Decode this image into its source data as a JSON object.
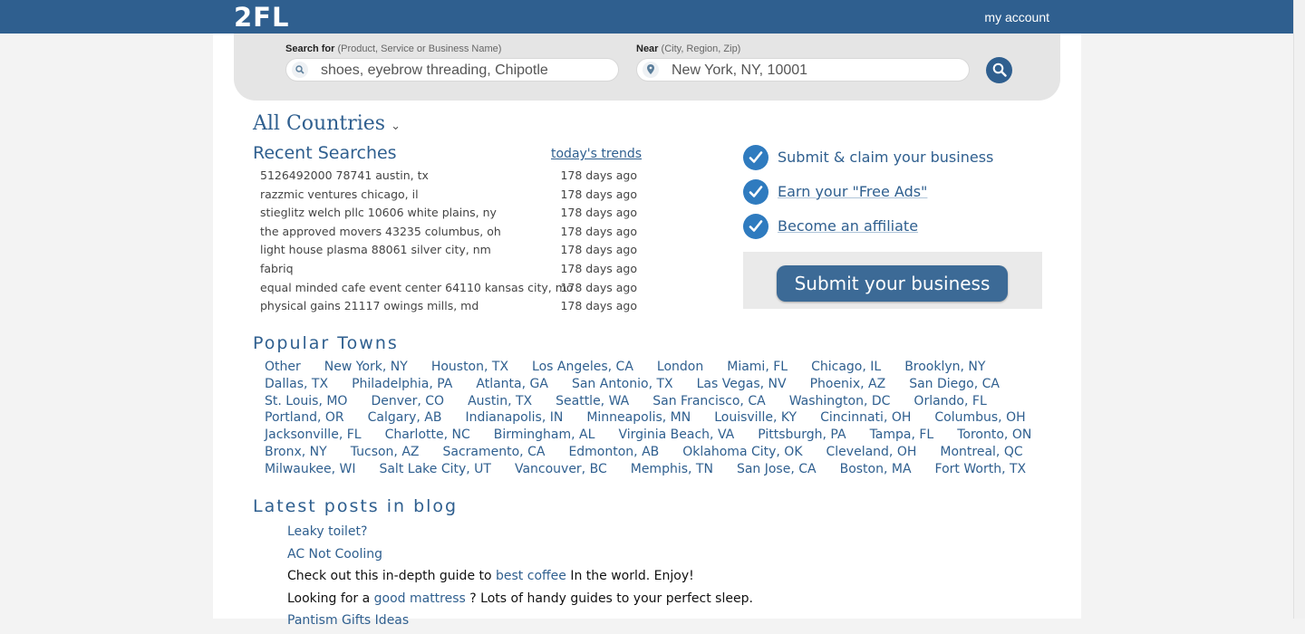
{
  "header": {
    "logo": "2FL",
    "account": "my account"
  },
  "search": {
    "what_label": "Search for",
    "what_hint": "(Product, Service or Business Name)",
    "what_placeholder": "shoes, eyebrow threading, Chipotle",
    "where_label": "Near",
    "where_hint": "(City, Region, Zip)",
    "where_placeholder": "New York, NY, 10001"
  },
  "countries": {
    "label": "All Countries"
  },
  "recent": {
    "title": "Recent Searches",
    "trends_link": "today's trends",
    "items": [
      {
        "query": "5126492000 78741 austin, tx",
        "ago": "178 days ago"
      },
      {
        "query": "razzmic ventures chicago, il",
        "ago": "178 days ago"
      },
      {
        "query": "stieglitz welch pllc 10606 white plains, ny",
        "ago": "178 days ago"
      },
      {
        "query": "the approved movers 43235 columbus, oh",
        "ago": "178 days ago"
      },
      {
        "query": "light house plasma 88061 silver city, nm",
        "ago": "178 days ago"
      },
      {
        "query": "fabriq",
        "ago": "178 days ago"
      },
      {
        "query": "equal minded cafe event center 64110 kansas city, mo",
        "ago": "178 days ago"
      },
      {
        "query": "physical gains 21117 owings mills, md",
        "ago": "178 days ago"
      }
    ]
  },
  "claims": [
    {
      "text": "Submit & claim your business"
    },
    {
      "text": "Earn your \"Free Ads\""
    },
    {
      "text": "Become an affiliate"
    }
  ],
  "submit_button": "Submit your business",
  "popular": {
    "title": "Popular Towns",
    "rows": [
      [
        "Other",
        "New York, NY",
        "Houston, TX",
        "Los Angeles, CA",
        "London",
        "Miami, FL",
        "Chicago, IL",
        "Brooklyn, NY"
      ],
      [
        "Dallas, TX",
        "Philadelphia, PA",
        "Atlanta, GA",
        "San Antonio, TX",
        "Las Vegas, NV",
        "Phoenix, AZ",
        "San Diego, CA"
      ],
      [
        "St. Louis, MO",
        "Denver, CO",
        "Austin, TX",
        "Seattle, WA",
        "San Francisco, CA",
        "Washington, DC",
        "Orlando, FL"
      ],
      [
        "Portland, OR",
        "Calgary, AB",
        "Indianapolis, IN",
        "Minneapolis, MN",
        "Louisville, KY",
        "Cincinnati, OH",
        "Columbus, OH"
      ],
      [
        "Jacksonville, FL",
        "Charlotte, NC",
        "Birmingham, AL",
        "Virginia Beach, VA",
        "Pittsburgh, PA",
        "Tampa, FL",
        "Toronto, ON"
      ],
      [
        "Bronx, NY",
        "Tucson, AZ",
        "Sacramento, CA",
        "Edmonton, AB",
        "Oklahoma City, OK",
        "Cleveland, OH",
        "Montreal, QC"
      ],
      [
        "Milwaukee, WI",
        "Salt Lake City, UT",
        "Vancouver, BC",
        "Memphis, TN",
        "San Jose, CA",
        "Boston, MA",
        "Fort Worth, TX"
      ]
    ]
  },
  "blog": {
    "title": "Latest posts in blog",
    "post1": "Leaky toilet?",
    "post2": "AC Not Cooling",
    "line3_pre": "Check out this in-depth guide to ",
    "line3_link": "best coffee",
    "line3_post": " In the world. Enjoy!",
    "line4_pre": "Looking for a ",
    "line4_link": "good mattress",
    "line4_post": " ? Lots of handy guides to your perfect sleep.",
    "post5": "Pantism Gifts Ideas"
  },
  "colors": {
    "header_bg": "#2f5f8f",
    "link": "#2f5f8f",
    "check": "#2f7bbf"
  }
}
